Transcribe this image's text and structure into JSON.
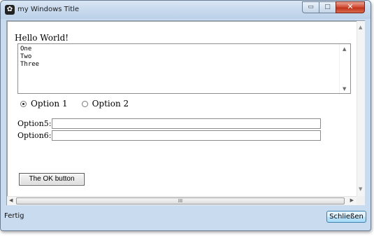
{
  "window": {
    "title": "my Windows Title",
    "icon": "app-logo-icon",
    "caption_minimize": "▭",
    "caption_maximize": "□",
    "caption_close": "✕"
  },
  "content": {
    "greeting": "Hello World!",
    "textarea_value": "One\nTwo\nThree",
    "radio_options": [
      {
        "label": "Option 1",
        "checked": true
      },
      {
        "label": "Option 2",
        "checked": false
      }
    ],
    "fields": [
      {
        "label": "Option5:",
        "value": ""
      },
      {
        "label": "Option6:",
        "value": ""
      }
    ],
    "ok_button_label": "The OK button",
    "hscroll_grip": "III"
  },
  "status": {
    "text": "Fertig",
    "close_button_label": "Schließen"
  },
  "colors": {
    "window_frame": "#c9dbee",
    "close_caption": "#c0341d",
    "close_button_border": "#3c7fb1"
  }
}
